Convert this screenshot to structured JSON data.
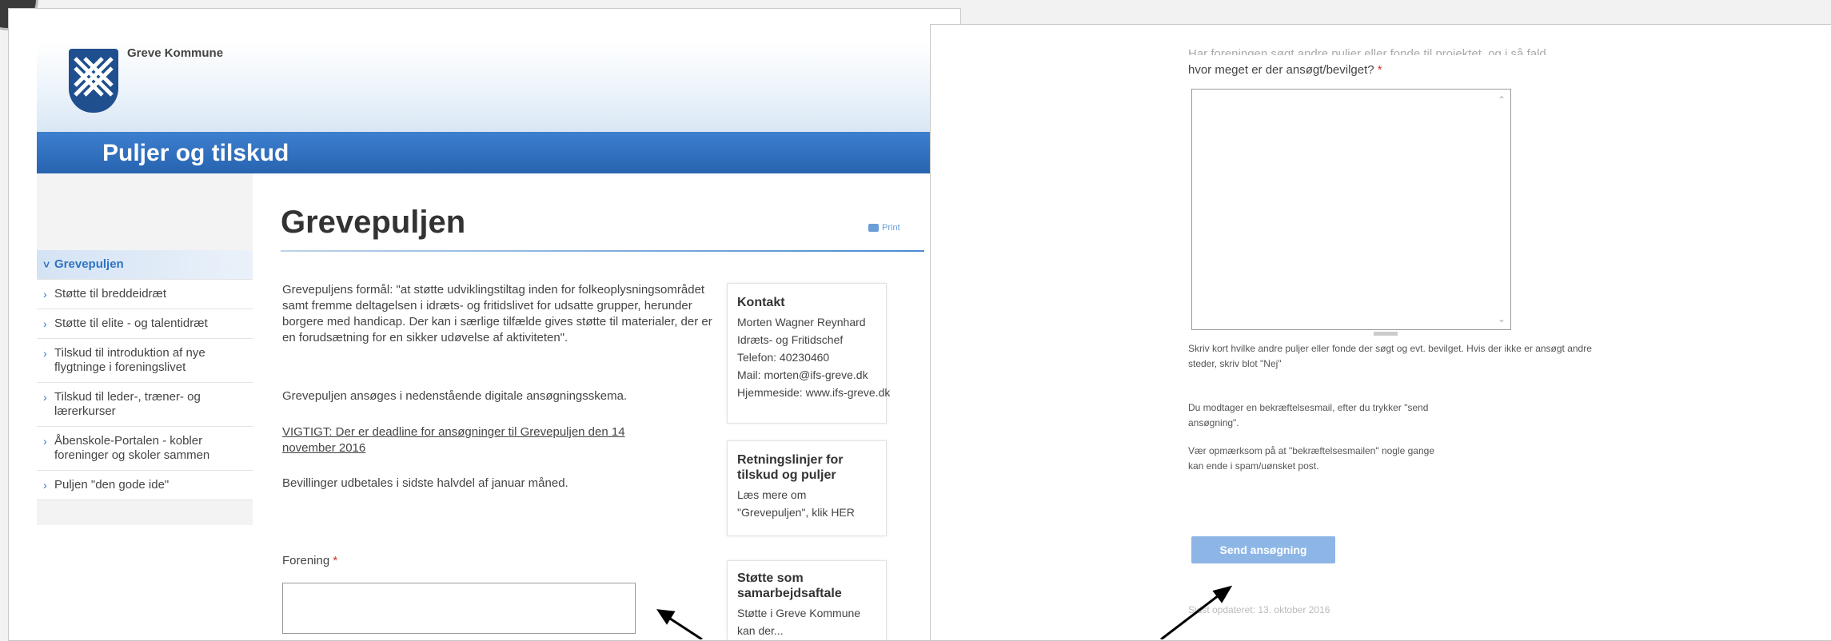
{
  "left_page": {
    "brand": "Greve Kommune",
    "section_title": "Puljer og tilskud",
    "sidebar": {
      "items": [
        {
          "label": "Grevepuljen",
          "active": true
        },
        {
          "label": "Støtte til breddeidræt"
        },
        {
          "label": "Støtte til elite - og talentidræt"
        },
        {
          "label": "Tilskud til introduktion af nye flygtninge i foreningslivet"
        },
        {
          "label": "Tilskud til leder-, træner- og lærerkurser"
        },
        {
          "label": "Åbenskole-Portalen - kobler foreninger og skoler sammen"
        },
        {
          "label": "Puljen \"den gode ide\""
        }
      ]
    },
    "page_title": "Grevepuljen",
    "print_label": "Print",
    "paragraphs": {
      "p1": "Grevepuljens formål: \"at støtte udviklingstiltag inden for folkeoplysningsområdet samt fremme deltagelsen i idræts- og fritidslivet for udsatte grupper, herunder borgere med handicap. Der kan i særlige tilfælde gives støtte til materialer, der er en forudsætning for en sikker udøvelse af aktiviteten\".",
      "p2": "Grevepuljen ansøges i nedenstående digitale ansøgningsskema.",
      "p3": "VIGTIGT: Der er deadline for ansøgninger til Grevepuljen den 14 november 2016",
      "p4": "Bevillinger udbetales i sidste halvdel af januar måned."
    },
    "form": {
      "field_label": "Forening",
      "required_mark": "*"
    },
    "contact_card": {
      "title": "Kontakt",
      "name": "Morten Wagner Reynhard",
      "role": "Idræts- og Fritidschef",
      "phone": "Telefon: 40230460",
      "mail": "Mail: morten@ifs-greve.dk",
      "web": "Hjemmeside: www.ifs-greve.dk"
    },
    "guidelines_card": {
      "title": "Retningslinjer for tilskud og puljer",
      "text": "Læs mere om \"Grevepuljen\", klik HER"
    },
    "partnership_card": {
      "title": "Støtte som samarbejdsaftale",
      "text": "Støtte i Greve Kommune kan der..."
    }
  },
  "right_page": {
    "question_cut": "Har foreningen søgt andre puljer eller fonde til projektet, og i så fald",
    "question": "hvor meget er der ansøgt/bevilget?",
    "required_mark": "*",
    "hint": "Skriv kort hvilke andre puljer eller fonde der søgt og evt. bevilget. Hvis der ikke er ansøgt andre steder, skriv blot \"Nej\"",
    "info1": "Du modtager en bekræftelsesmail, efter du trykker \"send ansøgning\".",
    "info2": "Vær opmærksom på at \"bekræftelsesmailen\" nogle gange kan ende i spam/uønsket post.",
    "send_button": "Send ansøgning",
    "footer": "Sidst opdateret: 13. oktober 2016"
  }
}
